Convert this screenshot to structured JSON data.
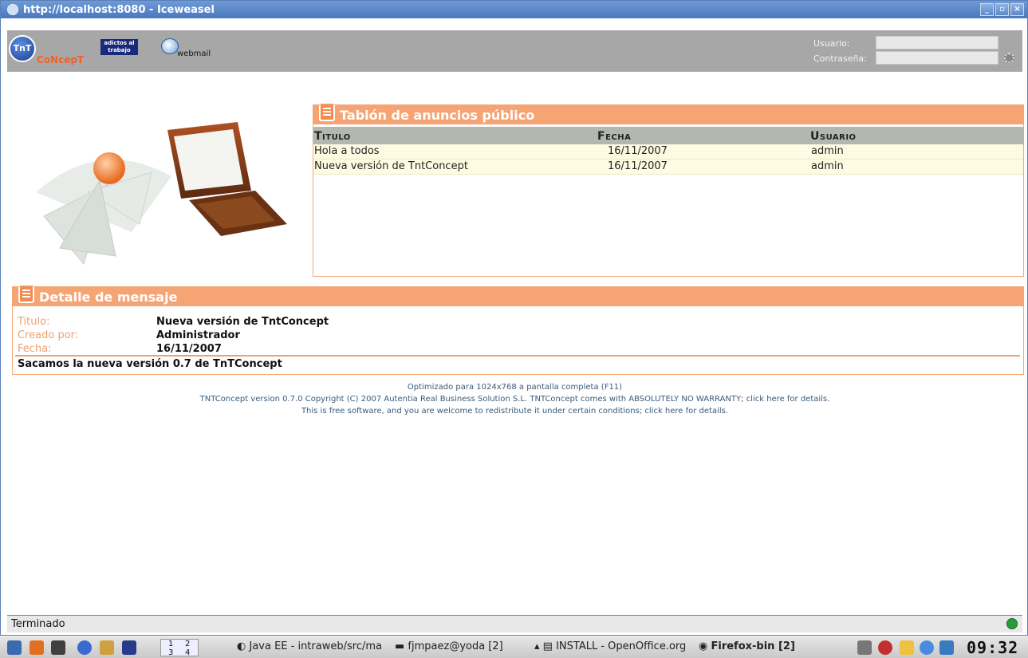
{
  "window": {
    "title": "http://localhost:8080 - Iceweasel"
  },
  "header": {
    "logo_text": "CoNcepT",
    "logo_badge": "TnT",
    "adictos_label": "adictos al trabajo",
    "webmail_label": "webmail",
    "usuario_label": "Usuario:",
    "password_label": "Contraseña:",
    "usuario_value": "",
    "password_value": ""
  },
  "announcements": {
    "title": "Tablón de anuncios público",
    "columns": [
      "Titulo",
      "Fecha",
      "Usuario"
    ],
    "rows": [
      {
        "titulo": "Hola a todos",
        "fecha": "16/11/2007",
        "usuario": "admin"
      },
      {
        "titulo": "Nueva versión de TntConcept",
        "fecha": "16/11/2007",
        "usuario": "admin"
      }
    ]
  },
  "detail": {
    "title": "Detalle de mensaje",
    "titulo_label": "Titulo:",
    "titulo_value": "Nueva versión de TntConcept",
    "creado_label": "Creado por:",
    "creado_value": "Administrador",
    "fecha_label": "Fecha:",
    "fecha_value": "16/11/2007",
    "body": "Sacamos la nueva versión 0.7 de TnTConcept"
  },
  "footer": {
    "line1": "Optimizado para 1024x768 a pantalla completa (F11)",
    "line2": "TNTConcept version 0.7.0 Copyright (C) 2007 Autentia Real Business Solution S.L. TNTConcept comes with ABSOLUTELY NO WARRANTY; click here for details.",
    "line3": "This is free software, and you are welcome to redistribute it under certain conditions; click here for details."
  },
  "status": {
    "text": "Terminado"
  },
  "taskbar": {
    "pager": [
      "1",
      "2",
      "3",
      "4"
    ],
    "tasks": [
      "Java EE - intraweb/src/ma",
      "fjmpaez@yoda [2]",
      "INSTALL - OpenOffice.org",
      "Firefox-bin [2]"
    ],
    "clock": "09:32"
  }
}
